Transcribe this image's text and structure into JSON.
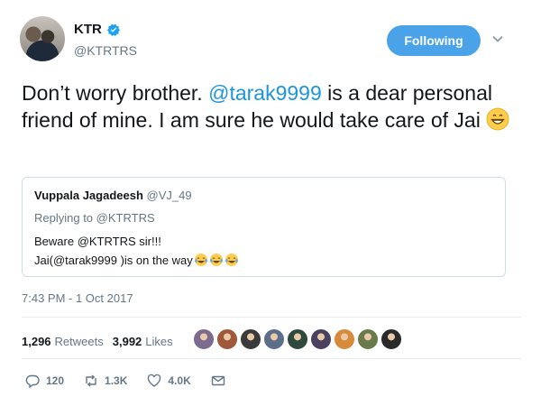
{
  "author": {
    "display_name": "KTR",
    "handle": "@KTRTRS",
    "avatar_icon": "profile-photo"
  },
  "follow_button": {
    "label": "Following",
    "color": "#4aa3e8"
  },
  "tweet": {
    "text_before": "Don’t worry brother. ",
    "mention": "@tarak9999",
    "text_after": " is a dear personal friend of mine. I am sure he would take care of Jai ",
    "emoji": "grinning-face-icon"
  },
  "quoted_tweet": {
    "author_name": "Vuppala Jagadeesh",
    "author_handle": "@VJ_49",
    "replying_label": "Replying to",
    "replying_handle": "@KTRTRS",
    "line1": "Beware @KTRTRS  sir!!!",
    "line2": "Jai(@tarak9999 )is on the way",
    "emoji": "tears-of-joy-icon"
  },
  "timestamp": "7:43 PM - 1 Oct 2017",
  "stats": {
    "retweets_count": "1,296",
    "retweets_label": "Retweets",
    "likes_count": "3,992",
    "likes_label": "Likes"
  },
  "likers_colors": [
    "#7d6a8f",
    "#a0573a",
    "#3a3a3a",
    "#5b6f8a",
    "#2f4a3c",
    "#4a4060",
    "#d88a3a",
    "#6a7a4a",
    "#2a2a2a"
  ],
  "actions": {
    "reply_count": "120",
    "retweet_count": "1.3K",
    "like_count": "4.0K"
  },
  "colors": {
    "accent": "#1b95e0",
    "secondary_text": "#657786",
    "border": "#d4dce3"
  }
}
